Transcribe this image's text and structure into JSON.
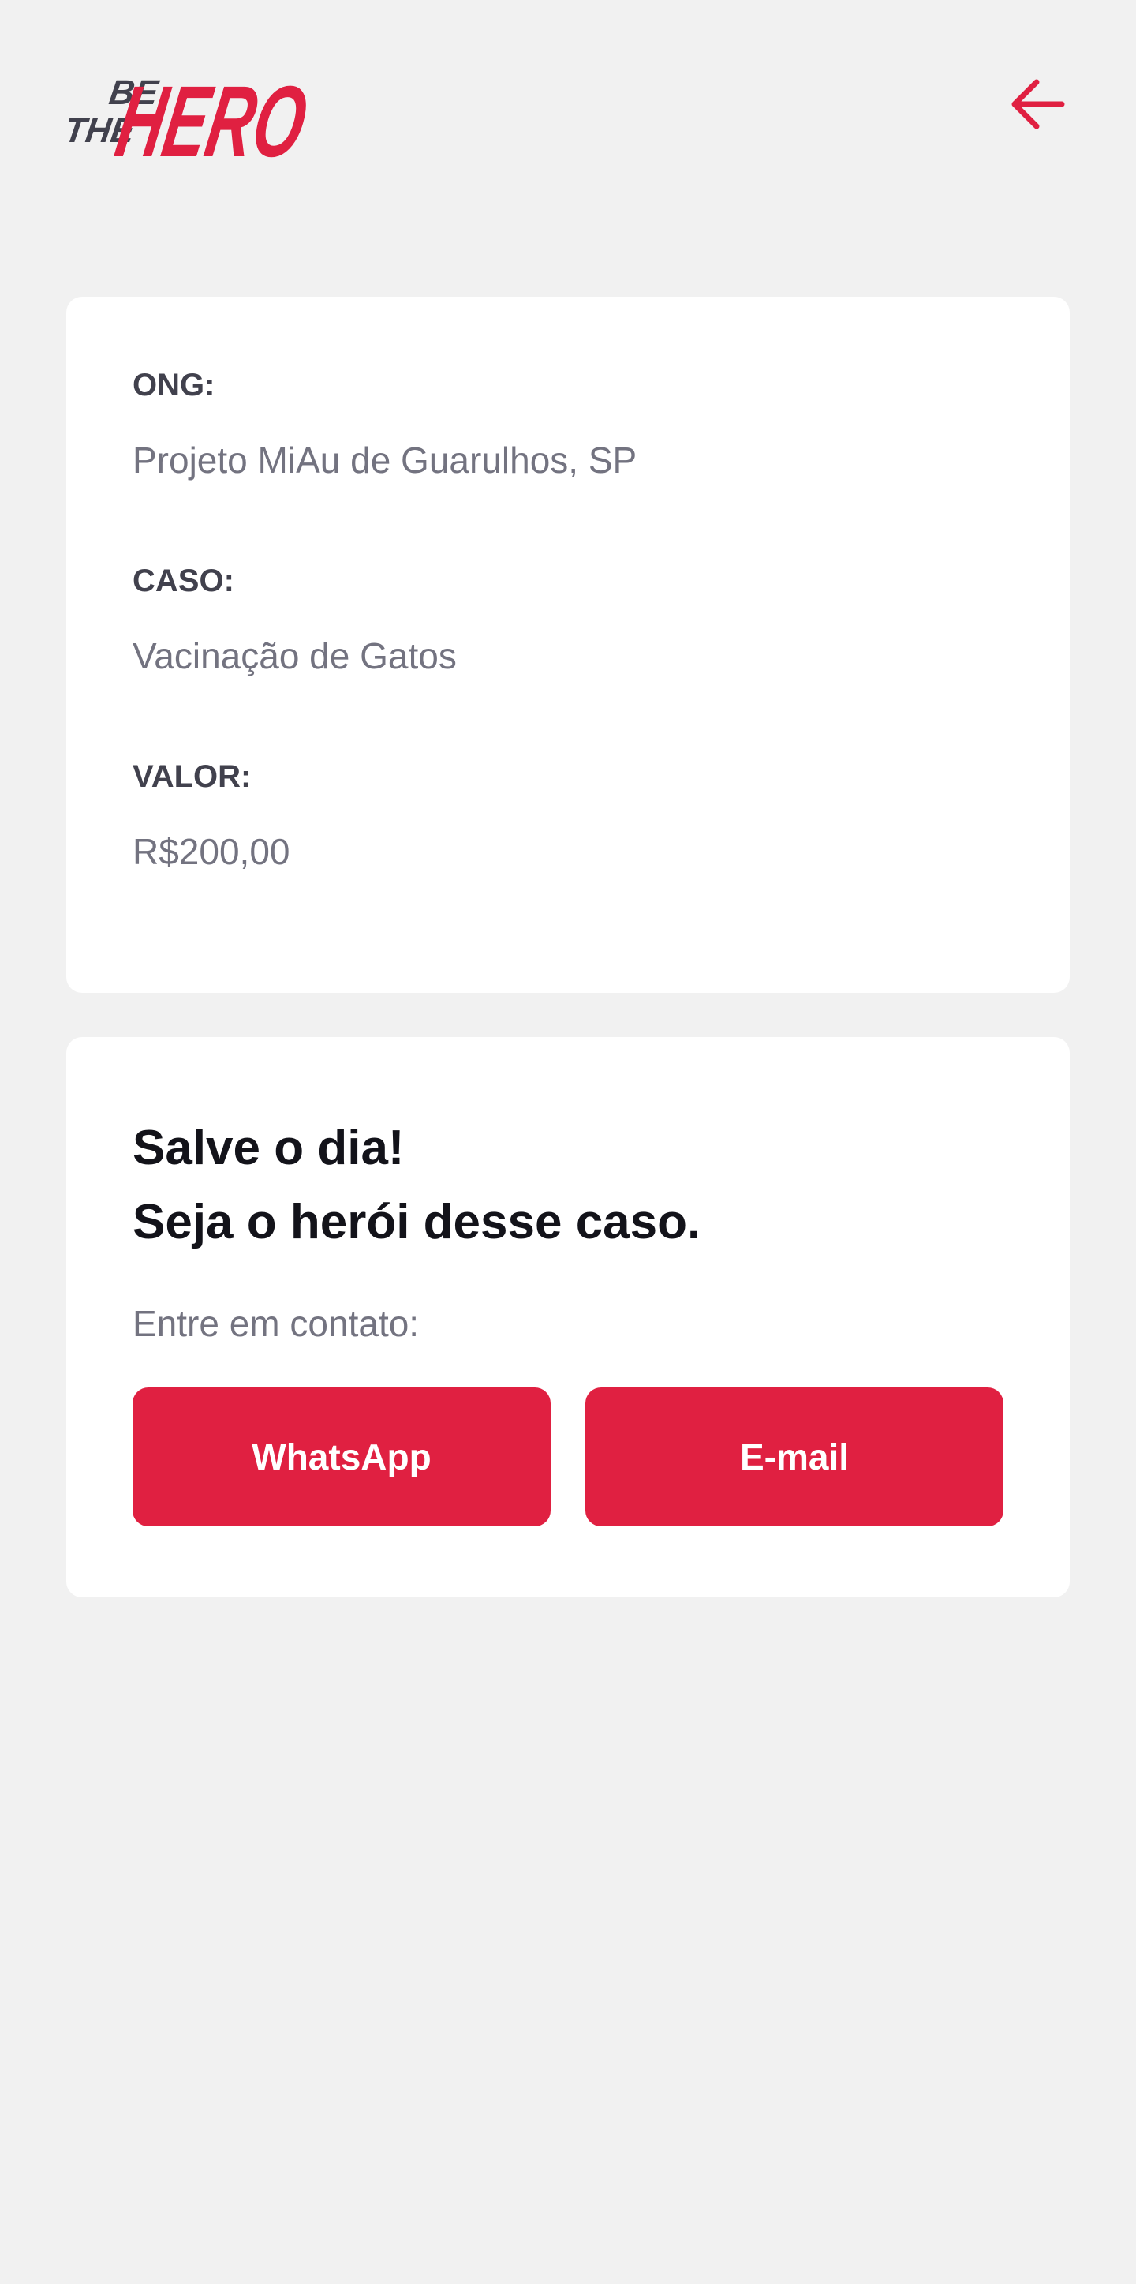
{
  "header": {
    "logo": {
      "line1": "BE",
      "line2": "THE",
      "main": "HERO"
    },
    "back_icon": "arrow-left-icon"
  },
  "incident": {
    "ong_label": "ONG:",
    "ong_value": "Projeto MiAu de Guarulhos, SP",
    "case_label": "CASO:",
    "case_value": "Vacinação de Gatos",
    "value_label": "VALOR:",
    "value_value": "R$200,00"
  },
  "contact": {
    "title_line1": "Salve o dia!",
    "title_line2": "Seja o herói desse caso.",
    "description": "Entre em contato:",
    "whatsapp_label": "WhatsApp",
    "email_label": "E-mail"
  },
  "colors": {
    "background": "#f1f1f1",
    "card": "#ffffff",
    "accent": "#e02041",
    "label": "#41414d",
    "muted": "#737380",
    "title": "#13131a"
  }
}
